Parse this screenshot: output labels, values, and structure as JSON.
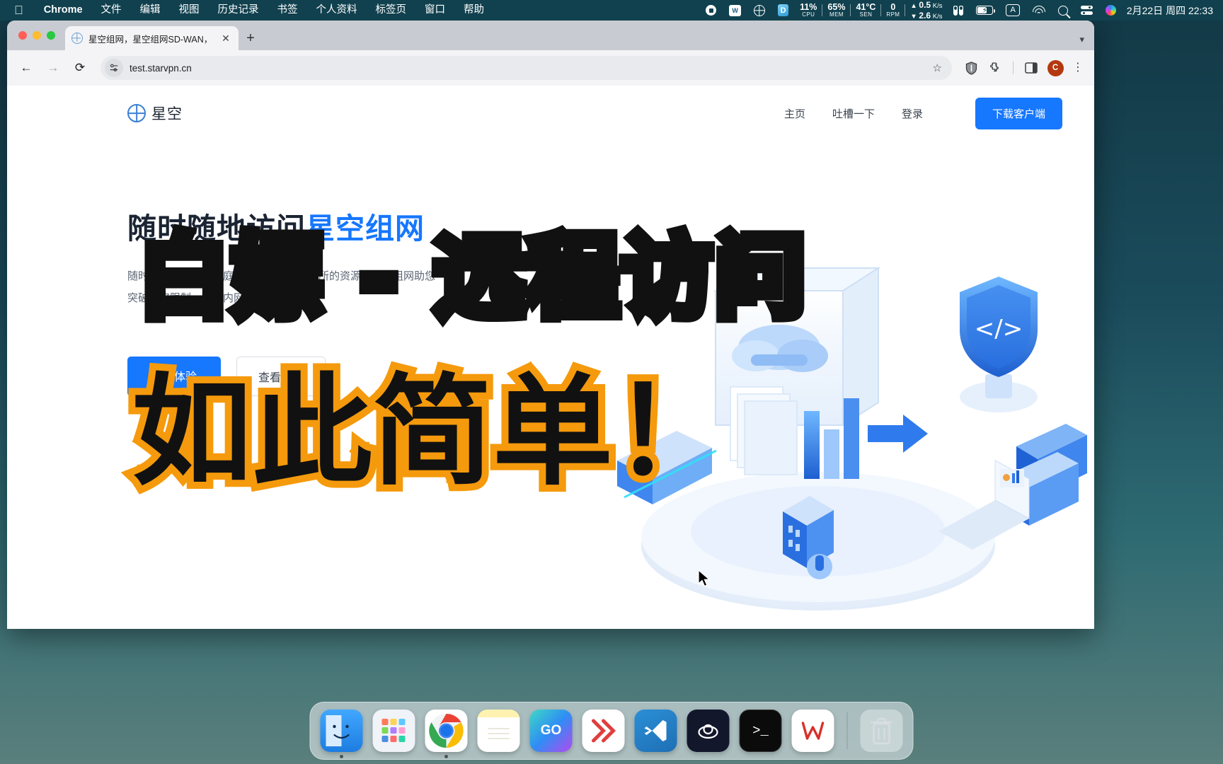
{
  "menubar": {
    "apple_icon": "apple-icon",
    "app_name": "Chrome",
    "items": [
      "文件",
      "编辑",
      "视图",
      "历史记录",
      "书签",
      "个人资料",
      "标签页",
      "窗口",
      "帮助"
    ],
    "status": {
      "cpu_value": "11%",
      "cpu_label": "CPU",
      "mem_value": "65%",
      "mem_label": "MEM",
      "sen_value": "41°C",
      "sen_label": "SEN",
      "rpm_value": "0",
      "rpm_label": "RPM",
      "net_up": "0.5",
      "net_up_unit": "K/s",
      "net_down": "2.6",
      "net_down_unit": "K/s",
      "input_source": "A"
    },
    "clock": "2月22日 周四  22:33"
  },
  "chrome": {
    "tab": {
      "title": "星空组网，星空组网SD-WAN，",
      "close_label": "✕"
    },
    "new_tab_label": "+",
    "toolbar": {
      "back_label": "←",
      "forward_label": "→",
      "reload_label": "⟳",
      "url": "test.starvpn.cn",
      "star_label": "☆",
      "profile_initial": "C",
      "menu_label": "⋮"
    }
  },
  "site": {
    "brand_name": "星空",
    "nav": [
      {
        "label": "主页"
      },
      {
        "label": "吐槽一下"
      },
      {
        "label": "登录"
      }
    ],
    "download_button": "下载客户端",
    "hero": {
      "heading_prefix": "随时随地访问",
      "heading_highlight": "星空组网",
      "paragraph_line1": "随时随地访问您的家庭、办公室、工作场所的资源，星空组网助您",
      "paragraph_line2": "突破网络限制，畅享内网。",
      "primary_button": "立即体验",
      "ghost_button": "查看文档"
    }
  },
  "overlay": {
    "line1": "白嫖 - 远程访问",
    "line2": "如此简单！",
    "line1_color": "#111111",
    "line2_fill": "#111111",
    "line2_stroke": "#f59a0c"
  },
  "colors": {
    "accent_blue": "#1677ff",
    "menubar_bg": "#11414f",
    "orange": "#f59a0c"
  },
  "dock": {
    "items": [
      {
        "name": "finder",
        "label": "Finder"
      },
      {
        "name": "launchpad",
        "label": "启动台"
      },
      {
        "name": "chrome",
        "label": "Chrome"
      },
      {
        "name": "notes",
        "label": "备忘录"
      },
      {
        "name": "goland",
        "label": "GoLand"
      },
      {
        "name": "logseq",
        "label": "Logseq"
      },
      {
        "name": "vscode",
        "label": "VS Code"
      },
      {
        "name": "cloud-app",
        "label": "Cloud"
      },
      {
        "name": "terminal",
        "label": "终端"
      },
      {
        "name": "wps",
        "label": "WPS"
      },
      {
        "name": "trash",
        "label": "废纸篓"
      }
    ]
  }
}
